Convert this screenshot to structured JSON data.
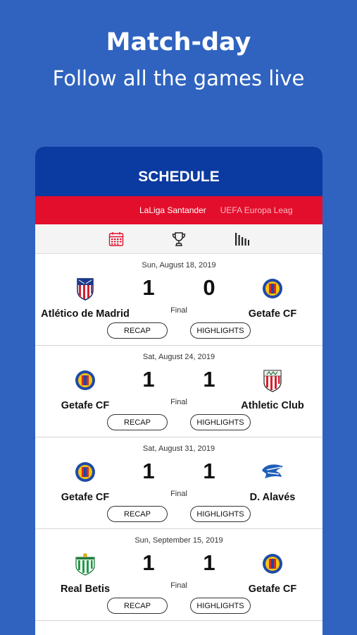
{
  "hero": {
    "title": "Match-day",
    "subtitle": "Follow all the games live"
  },
  "app": {
    "title": "SCHEDULE",
    "leagues": [
      "LaLiga Santander",
      "UEFA Europa Leag"
    ],
    "tabs": [
      "calendar-icon",
      "trophy-icon",
      "standings-icon"
    ],
    "accent": "#e30e2c",
    "header_color": "#0b3aa0"
  },
  "matches": [
    {
      "date": "Sun, August 18, 2019",
      "home": "Atlético de Madrid",
      "away": "Getafe CF",
      "home_score": "1",
      "away_score": "0",
      "status": "Final",
      "recap": "RECAP",
      "highlights": "HIGHLIGHTS",
      "home_crest": "atletico-crest",
      "away_crest": "getafe-crest"
    },
    {
      "date": "Sat, August 24, 2019",
      "home": "Getafe CF",
      "away": "Athletic Club",
      "home_score": "1",
      "away_score": "1",
      "status": "Final",
      "recap": "RECAP",
      "highlights": "HIGHLIGHTS",
      "home_crest": "getafe-crest",
      "away_crest": "athletic-crest"
    },
    {
      "date": "Sat, August 31, 2019",
      "home": "Getafe CF",
      "away": "D. Alavés",
      "home_score": "1",
      "away_score": "1",
      "status": "Final",
      "recap": "RECAP",
      "highlights": "HIGHLIGHTS",
      "home_crest": "getafe-crest",
      "away_crest": "alaves-crest"
    },
    {
      "date": "Sun, September 15, 2019",
      "home": "Real Betis",
      "away": "Getafe CF",
      "home_score": "1",
      "away_score": "1",
      "status": "Final",
      "recap": "RECAP",
      "highlights": "HIGHLIGHTS",
      "home_crest": "betis-crest",
      "away_crest": "getafe-crest"
    }
  ]
}
